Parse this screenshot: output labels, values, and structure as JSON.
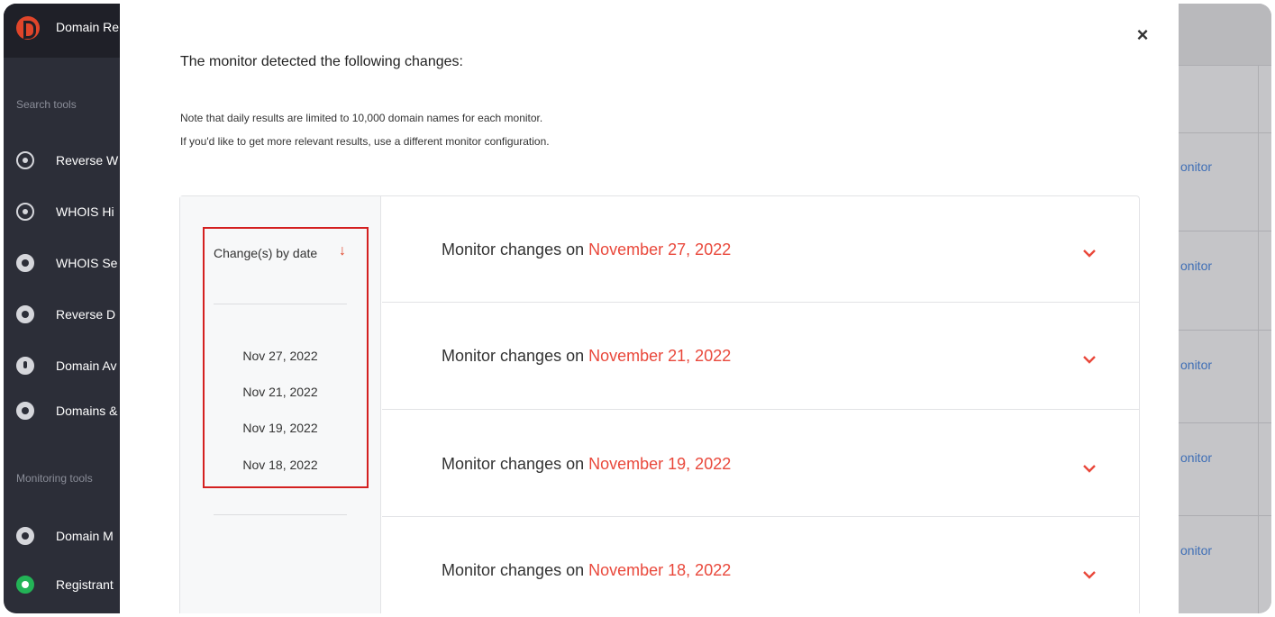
{
  "sidebar": {
    "title": "Domain Re",
    "sections": {
      "search": "Search tools",
      "monitoring": "Monitoring tools"
    },
    "search_items": [
      {
        "label": "Reverse W",
        "icon": "reverse-whois-icon"
      },
      {
        "label": "WHOIS Hi",
        "icon": "whois-history-icon"
      },
      {
        "label": "WHOIS Se",
        "icon": "whois-search-icon"
      },
      {
        "label": "Reverse D",
        "icon": "globe-icon"
      },
      {
        "label": "Domain Av",
        "icon": "domain-availability-icon"
      },
      {
        "label": "Domains &",
        "icon": "domains-subdomains-icon"
      }
    ],
    "monitoring_items": [
      {
        "label": "Domain M",
        "icon": "domain-monitor-icon"
      },
      {
        "label": "Registrant",
        "icon": "registrant-monitor-icon"
      }
    ]
  },
  "background": {
    "links": [
      "onitor",
      "onitor",
      "onitor",
      "onitor",
      "onitor"
    ]
  },
  "modal": {
    "close_label": "×",
    "title": "The monitor detected the following changes:",
    "note_line1": "Note that daily results are limited to 10,000 domain names for each monitor.",
    "note_line2": "If you'd like to get more relevant results, use a different monitor configuration.",
    "sort_label": "Change(s) by date",
    "sort_arrow": "↓",
    "dates": [
      "Nov 27, 2022",
      "Nov 21, 2022",
      "Nov 19, 2022",
      "Nov 18, 2022"
    ],
    "rows": [
      {
        "prefix": "Monitor changes on",
        "date": "November 27, 2022"
      },
      {
        "prefix": "Monitor changes on",
        "date": "November 21, 2022"
      },
      {
        "prefix": "Monitor changes on",
        "date": "November 19, 2022"
      },
      {
        "prefix": "Monitor changes on",
        "date": "November 18, 2022"
      }
    ]
  },
  "colors": {
    "accent": "#e9483b",
    "highlight_border": "#d42020",
    "sidebar_bg": "#2c2e38",
    "link": "#3f6fb6"
  }
}
